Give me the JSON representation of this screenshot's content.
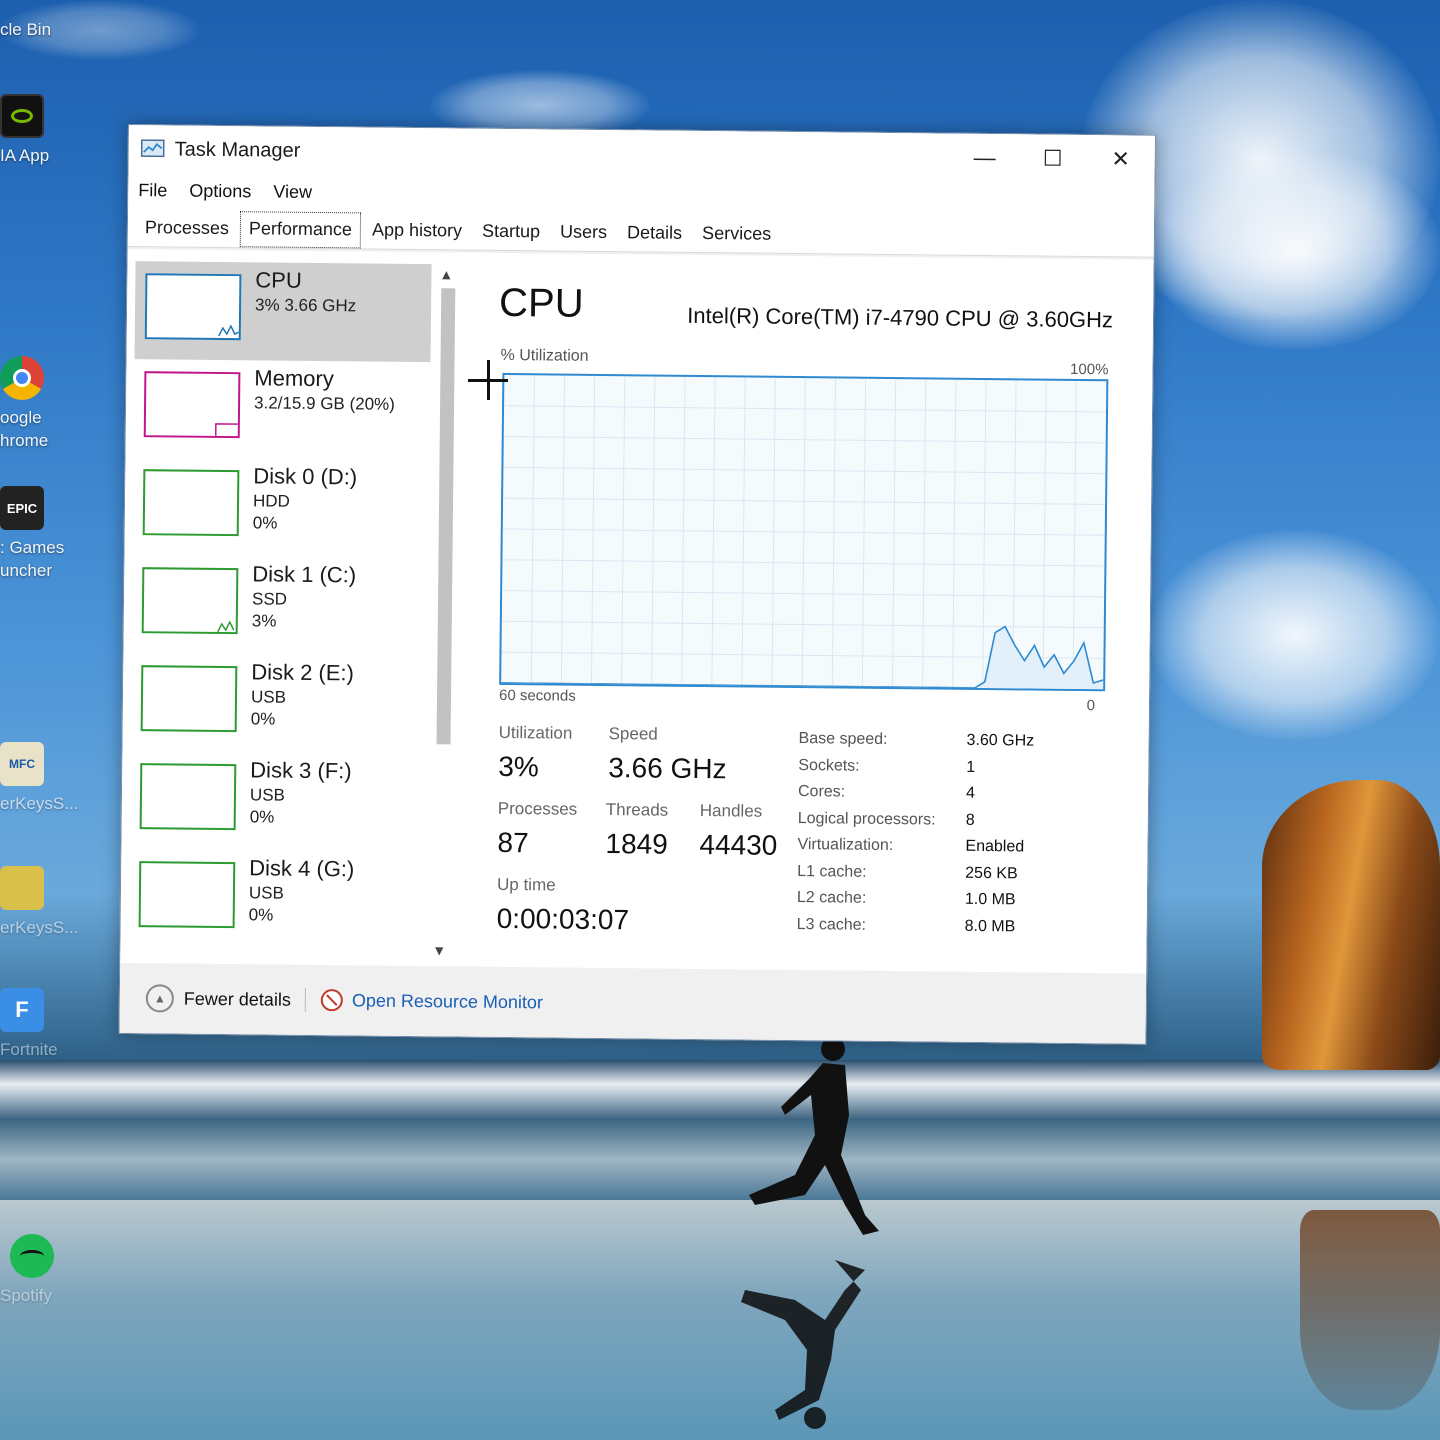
{
  "desktop": {
    "icons": [
      {
        "name": "recycle-bin",
        "label1": "cle Bin",
        "label2": ""
      },
      {
        "name": "nvidia-app",
        "label1": "IA App",
        "label2": ""
      },
      {
        "name": "google-chrome",
        "label1": "oogle",
        "label2": "hrome"
      },
      {
        "name": "epic-games",
        "label1": ": Games",
        "label2": "uncher",
        "glyph": "EPIC"
      },
      {
        "name": "keys-app-1",
        "label1": "erKeysS...",
        "label2": "",
        "glyph": "MFC"
      },
      {
        "name": "keys-app-2",
        "label1": "erKeysS...",
        "label2": ""
      },
      {
        "name": "fortnite",
        "label1": "Fortnite",
        "label2": "",
        "glyph": "F"
      },
      {
        "name": "spotify",
        "label1": "Spotify",
        "label2": ""
      }
    ]
  },
  "window": {
    "title": "Task Manager",
    "controls": {
      "minimize": "—",
      "maximize": "☐",
      "close": "✕"
    },
    "menu": [
      "File",
      "Options",
      "View"
    ],
    "tabs": [
      "Processes",
      "Performance",
      "App history",
      "Startup",
      "Users",
      "Details",
      "Services"
    ],
    "active_tab": "Performance"
  },
  "sidebar": {
    "items": [
      {
        "name": "CPU",
        "line1": "3%  3.66 GHz",
        "line2": "",
        "color": "#1f78b4"
      },
      {
        "name": "Memory",
        "line1": "3.2/15.9 GB (20%)",
        "line2": "",
        "color": "#c0188c"
      },
      {
        "name": "Disk 0 (D:)",
        "line1": "HDD",
        "line2": "0%",
        "color": "#2e9b32"
      },
      {
        "name": "Disk 1 (C:)",
        "line1": "SSD",
        "line2": "3%",
        "color": "#2e9b32"
      },
      {
        "name": "Disk 2 (E:)",
        "line1": "USB",
        "line2": "0%",
        "color": "#2e9b32"
      },
      {
        "name": "Disk 3 (F:)",
        "line1": "USB",
        "line2": "0%",
        "color": "#2e9b32"
      },
      {
        "name": "Disk 4 (G:)",
        "line1": "USB",
        "line2": "0%",
        "color": "#2e9b32"
      }
    ]
  },
  "detail": {
    "title": "CPU",
    "model": "Intel(R) Core(TM) i7-4790 CPU @ 3.60GHz",
    "util_label": "% Utilization",
    "max_label": "100%",
    "time_label": "60 seconds",
    "min_label": "0",
    "graph_color": "#2f8ad1",
    "graph_series": [
      0,
      0,
      0,
      0,
      0,
      0,
      0,
      0,
      0,
      0,
      0,
      0,
      0,
      0,
      0,
      0,
      0,
      0,
      0,
      0,
      0,
      0,
      0,
      0,
      0,
      0,
      0,
      0,
      0,
      0,
      0,
      0,
      0,
      0,
      0,
      0,
      0,
      0,
      0,
      0,
      0,
      0,
      0,
      0,
      0,
      0,
      0,
      0,
      0,
      2,
      18,
      20,
      14,
      9,
      14,
      7,
      11,
      5,
      9,
      15,
      2,
      3
    ],
    "stats": {
      "utilization": {
        "label": "Utilization",
        "value": "3%"
      },
      "speed": {
        "label": "Speed",
        "value": "3.66 GHz"
      },
      "processes": {
        "label": "Processes",
        "value": "87"
      },
      "threads": {
        "label": "Threads",
        "value": "1849"
      },
      "handles": {
        "label": "Handles",
        "value": "44430"
      },
      "uptime": {
        "label": "Up time",
        "value": "0:00:03:07"
      }
    },
    "specs": [
      {
        "k": "Base speed:",
        "v": "3.60 GHz"
      },
      {
        "k": "Sockets:",
        "v": "1"
      },
      {
        "k": "Cores:",
        "v": "4"
      },
      {
        "k": "Logical processors:",
        "v": "8"
      },
      {
        "k": "Virtualization:",
        "v": "Enabled"
      },
      {
        "k": "L1 cache:",
        "v": "256 KB"
      },
      {
        "k": "L2 cache:",
        "v": "1.0 MB"
      },
      {
        "k": "L3 cache:",
        "v": "8.0 MB"
      }
    ]
  },
  "footer": {
    "fewer_details": "Fewer details",
    "open_resource_monitor": "Open Resource Monitor"
  }
}
